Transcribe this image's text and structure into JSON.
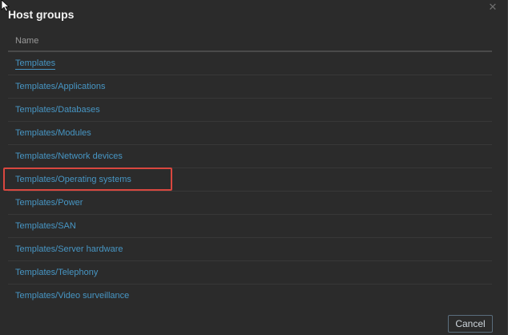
{
  "dialog": {
    "title": "Host groups",
    "close_glyph": "✕",
    "table_header": "Name",
    "rows": [
      "Templates",
      "Templates/Applications",
      "Templates/Databases",
      "Templates/Modules",
      "Templates/Network devices",
      "Templates/Operating systems",
      "Templates/Power",
      "Templates/SAN",
      "Templates/Server hardware",
      "Templates/Telephony",
      "Templates/Video surveillance"
    ],
    "cancel_label": "Cancel"
  },
  "icons": {
    "close": "close-icon",
    "cursor": "mouse-pointer-icon"
  },
  "colors": {
    "background": "#2b2b2b",
    "link": "#4796c4",
    "highlight": "#d9473f"
  }
}
